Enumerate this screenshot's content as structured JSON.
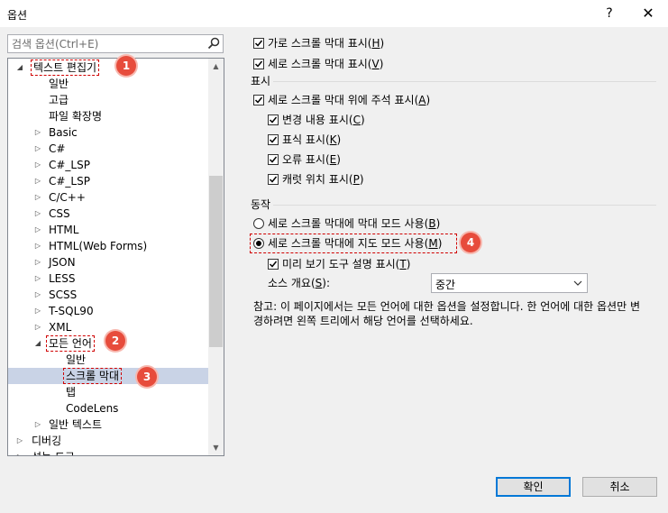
{
  "window": {
    "title": "옵션",
    "help_label": "?",
    "close_label": "✕"
  },
  "search": {
    "placeholder": "검색 옵션(Ctrl+E)"
  },
  "tree": {
    "items": [
      {
        "label": "텍스트 편집기",
        "expander": "◢"
      },
      {
        "label": "일반"
      },
      {
        "label": "고급"
      },
      {
        "label": "파일 확장명"
      },
      {
        "label": "Basic",
        "expander": "▷"
      },
      {
        "label": "C#",
        "expander": "▷"
      },
      {
        "label": "C#_LSP",
        "expander": "▷"
      },
      {
        "label": "C#_LSP",
        "expander": "▷"
      },
      {
        "label": "C/C++",
        "expander": "▷"
      },
      {
        "label": "CSS",
        "expander": "▷"
      },
      {
        "label": "HTML",
        "expander": "▷"
      },
      {
        "label": "HTML(Web Forms)",
        "expander": "▷"
      },
      {
        "label": "JSON",
        "expander": "▷"
      },
      {
        "label": "LESS",
        "expander": "▷"
      },
      {
        "label": "SCSS",
        "expander": "▷"
      },
      {
        "label": "T-SQL90",
        "expander": "▷"
      },
      {
        "label": "XML",
        "expander": "▷"
      },
      {
        "label": "모든 언어",
        "expander": "◢"
      },
      {
        "label": "일반"
      },
      {
        "label": "스크롤 막대"
      },
      {
        "label": "탭"
      },
      {
        "label": "CodeLens"
      },
      {
        "label": "일반 텍스트",
        "expander": "▷"
      },
      {
        "label": "디버깅",
        "expander": "▷"
      },
      {
        "label": "성능 도구",
        "expander": "▷"
      }
    ],
    "scroll_up": "▲",
    "scroll_down": "▼"
  },
  "badges": [
    "1",
    "2",
    "3",
    "4"
  ],
  "scrollbars": {
    "show_horizontal": {
      "label": "가로 스크롤 막대 표시(",
      "key": "H",
      "tail": ")",
      "checked": true
    },
    "show_vertical": {
      "label": "세로 스크롤 막대 표시(",
      "key": "V",
      "tail": ")",
      "checked": true
    }
  },
  "display": {
    "heading": "표시",
    "annotations": {
      "label": "세로 스크롤 막대 위에 주석 표시(",
      "key": "A",
      "tail": ")",
      "checked": true
    },
    "changes": {
      "label": "변경 내용 표시(",
      "key": "C",
      "tail": ")",
      "checked": true
    },
    "marks": {
      "label": "표식 표시(",
      "key": "K",
      "tail": ")",
      "checked": true
    },
    "errors": {
      "label": "오류 표시(",
      "key": "E",
      "tail": ")",
      "checked": true
    },
    "caret": {
      "label": "캐럿 위치 표시(",
      "key": "P",
      "tail": ")",
      "checked": true
    }
  },
  "behavior": {
    "heading": "동작",
    "bar_mode": {
      "label": "세로 스크롤 막대에 막대 모드 사용(",
      "key": "B",
      "tail": ")",
      "selected": false
    },
    "map_mode": {
      "label": "세로 스크롤 막대에 지도 모드 사용(",
      "key": "M",
      "tail": ")",
      "selected": true
    },
    "preview_tooltip": {
      "label": "미리 보기 도구 설명 표시(",
      "key": "T",
      "tail": ")",
      "checked": true
    },
    "source_overview_label": "소스 개요(",
    "source_overview_key": "S",
    "source_overview_tail": "):",
    "source_overview_value": "중간"
  },
  "note": "참고: 이 페이지에서는 모든 언어에 대한 옵션을 설정합니다. 한 언어에 대한 옵션만 변경하려면 왼쪽 트리에서 해당 언어를 선택하세요.",
  "buttons": {
    "ok": "확인",
    "cancel": "취소"
  }
}
